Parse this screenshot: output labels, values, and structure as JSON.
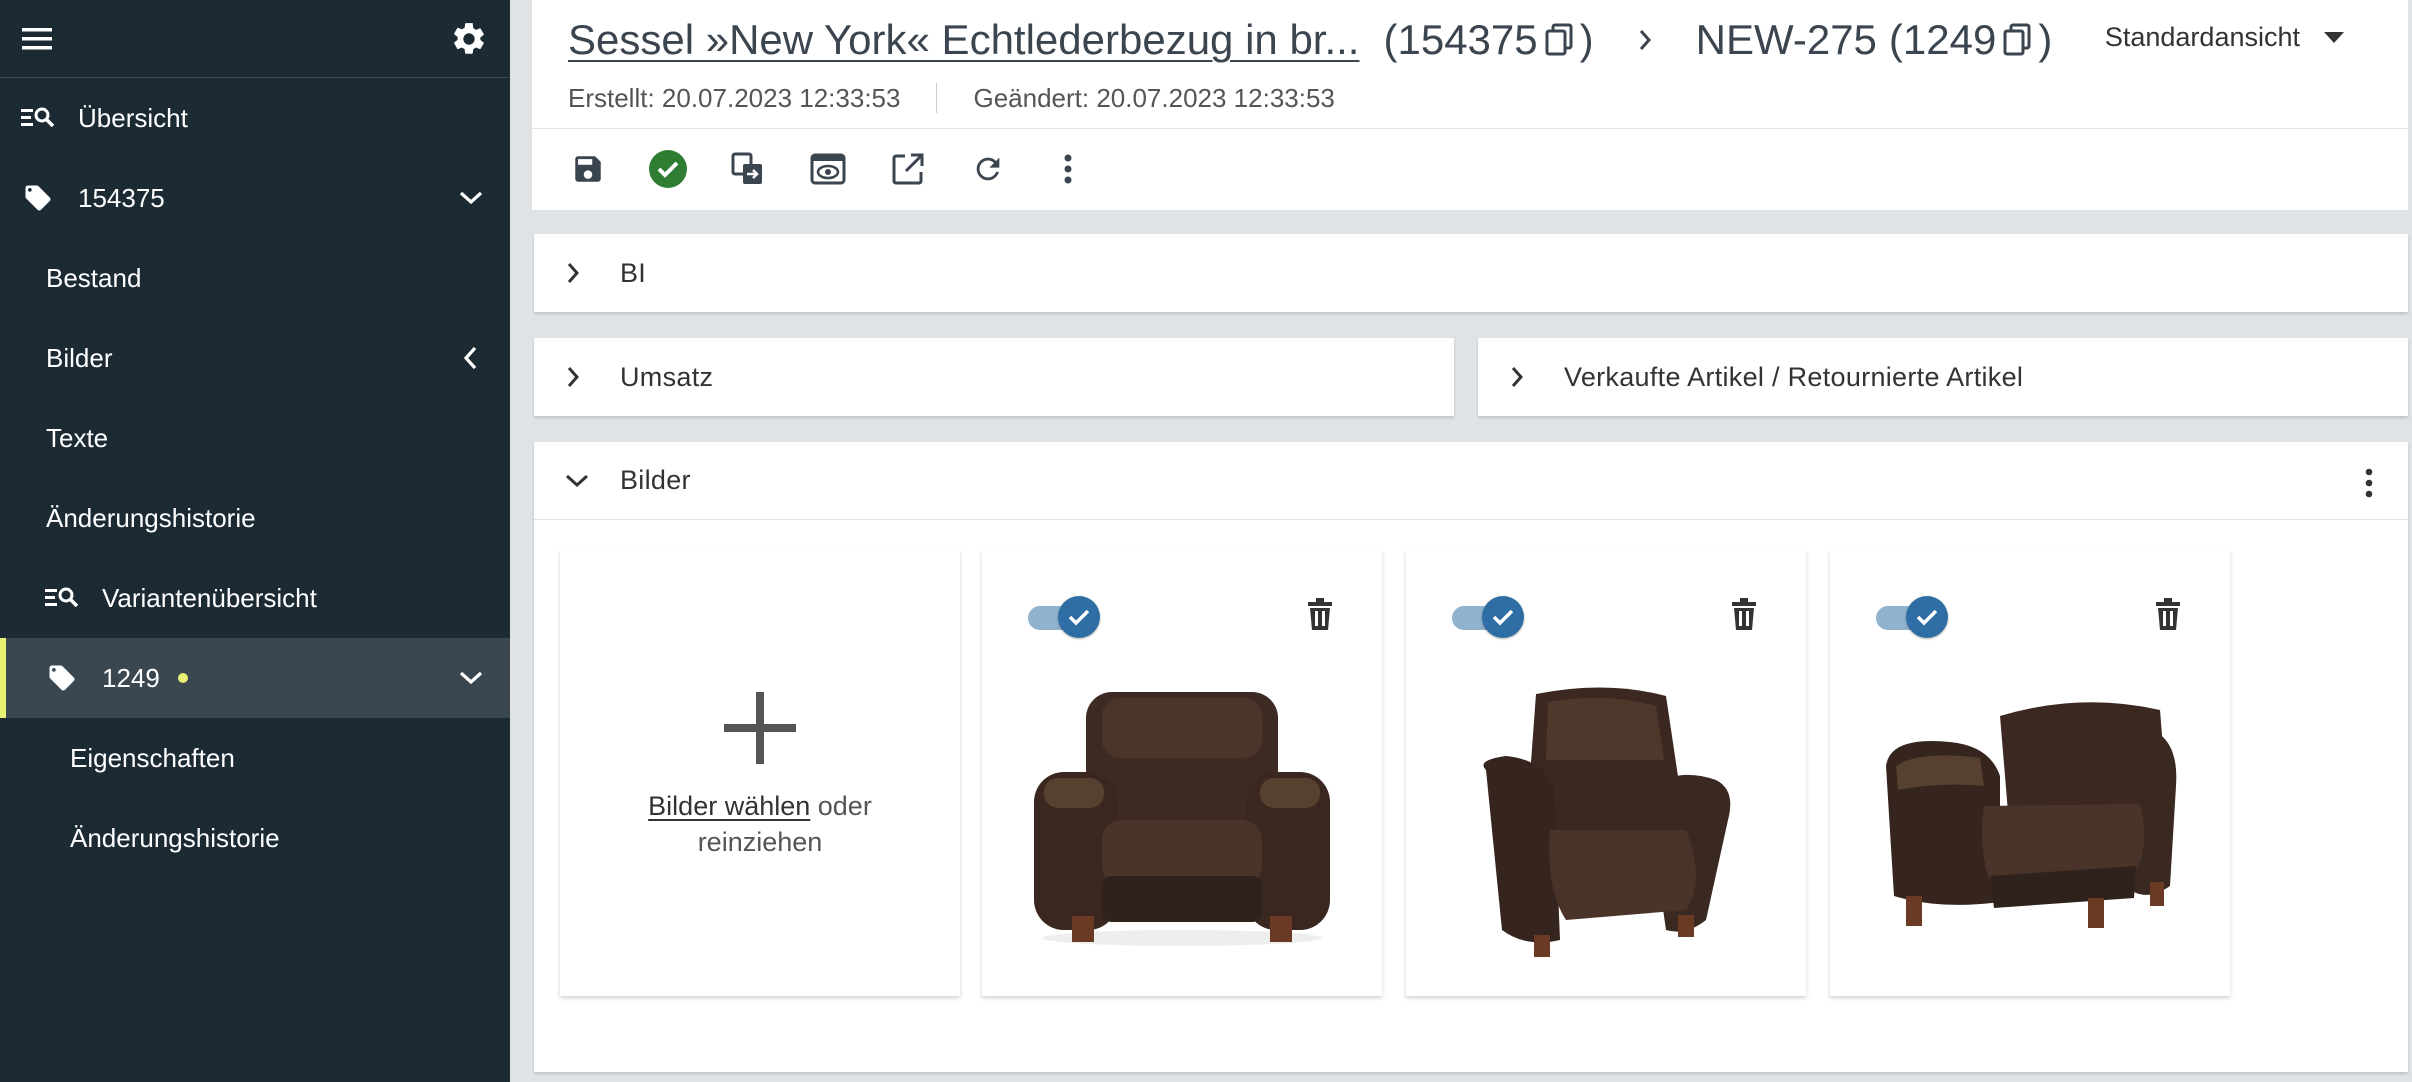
{
  "sidebar": {
    "items": [
      {
        "label": "Übersicht"
      },
      {
        "label": "154375"
      },
      {
        "label": "Bestand"
      },
      {
        "label": "Bilder"
      },
      {
        "label": "Texte"
      },
      {
        "label": "Änderungshistorie"
      },
      {
        "label": "Variantenübersicht"
      },
      {
        "label": "1249"
      },
      {
        "label": "Eigenschaften"
      },
      {
        "label": "Änderungshistorie"
      }
    ]
  },
  "header": {
    "title": "Sessel »New York« Echtlederbezug in br...",
    "product_id_open": "(154375",
    "product_id_close": ")",
    "variant_name": "NEW-275",
    "variant_id_open": "(1249",
    "variant_id_close": ")",
    "view_select": "Standardansicht",
    "created": "Erstellt: 20.07.2023 12:33:53",
    "modified": "Geändert: 20.07.2023 12:33:53"
  },
  "panels": {
    "bi": "BI",
    "umsatz": "Umsatz",
    "verkaufte": "Verkaufte Artikel / Retournierte Artikel",
    "bilder": "Bilder"
  },
  "upload": {
    "link": "Bilder wählen",
    "rest1": " oder",
    "rest2": "reinziehen"
  },
  "colors": {
    "sidebar_bg": "#1c2a34",
    "active_accent": "#e8f173",
    "check_green": "#2e7d32",
    "toggle_blue": "#2f6ea4"
  }
}
